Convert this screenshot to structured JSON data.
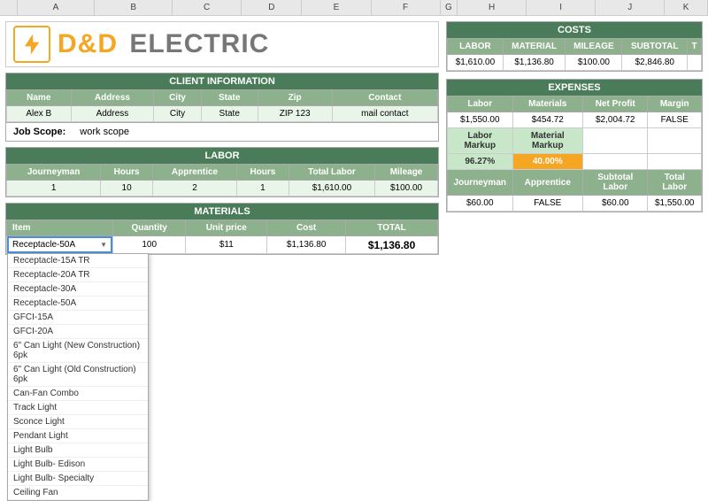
{
  "company": {
    "name_part1": "D&D",
    "name_part2": "ELECTRIC"
  },
  "client_information": {
    "section_title": "CLIENT INFORMATION",
    "columns": [
      "Name",
      "Address",
      "City",
      "State",
      "Zip",
      "Contact"
    ],
    "row": {
      "name": "Alex B",
      "address": "Address",
      "city": "City",
      "state": "State",
      "zip": "ZIP 123",
      "contact": "mail contact"
    },
    "job_scope_label": "Job Scope:",
    "job_scope_value": "work scope"
  },
  "labor": {
    "section_title": "LABOR",
    "columns": [
      "Journeyman",
      "Hours",
      "Apprentice",
      "Hours",
      "Total Labor",
      "Mileage"
    ],
    "row": {
      "journeyman": "1",
      "hours": "10",
      "apprentice": "2",
      "app_hours": "1",
      "total_labor": "$1,610.00",
      "mileage": "$100.00"
    }
  },
  "materials": {
    "section_title": "MATERIALS",
    "columns": [
      "Item",
      "Quantity",
      "Unit price",
      "Cost",
      "TOTAL"
    ],
    "rows": [
      {
        "item": "Receptacle-50A",
        "quantity": "100",
        "unit_price": "$11",
        "cost": "$1,136.80",
        "total": ""
      }
    ],
    "total_label": "",
    "total_value": "$1,136.80",
    "dropdown_selected": "Receptacle-50A",
    "dropdown_items": [
      "Receptacle-15A TR",
      "Receptacle-20A TR",
      "Receptacle-30A",
      "Receptacle-50A",
      "GFCI-15A",
      "GFCI-20A",
      "6\" Can Light (New Construction) 6pk",
      "6\" Can Light (Old Construction) 6pk",
      "Can-Fan Combo",
      "Track Light",
      "Sconce Light",
      "Pendant Light",
      "Light Bulb",
      "Light Bulb- Edison",
      "Light Bulb- Specialty",
      "Ceiling Fan"
    ]
  },
  "costs": {
    "section_title": "COSTS",
    "columns": [
      "LABOR",
      "MATERIAL",
      "MILEAGE",
      "SUBTOTAL",
      "T"
    ],
    "row": {
      "labor": "$1,610.00",
      "material": "$1,136.80",
      "mileage": "$100.00",
      "subtotal": "$2,846.80"
    }
  },
  "expenses": {
    "section_title": "EXPENSES",
    "columns": [
      "Labor",
      "Materials",
      "Net Profit",
      "Margin"
    ],
    "row1": {
      "labor": "$1,550.00",
      "materials": "$454.72",
      "net_profit": "$2,004.72",
      "margin": "FALSE"
    },
    "markup_labels": [
      "Labor Markup",
      "Material Markup"
    ],
    "markup_values": [
      "96.27%",
      "40.00%"
    ],
    "columns2": [
      "Journeyman",
      "Apprentice",
      "Subtotal Labor",
      "Total Labor"
    ],
    "row2": {
      "journeyman": "$60.00",
      "apprentice": "FALSE",
      "subtotal_labor": "$60.00",
      "total_labor": "$1,550.00"
    }
  },
  "col_headers": [
    "A",
    "B",
    "C",
    "D",
    "E",
    "F",
    "G",
    "H",
    "I",
    "J",
    "K"
  ]
}
